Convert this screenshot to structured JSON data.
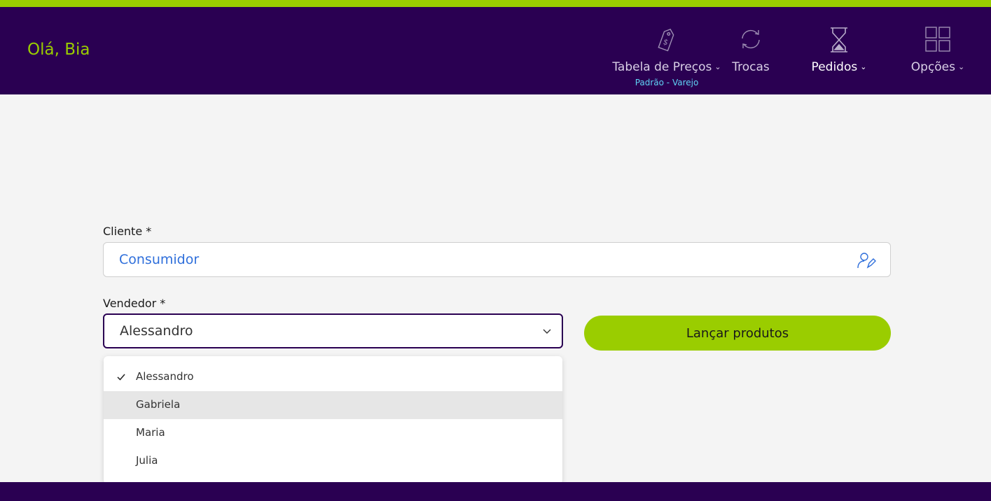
{
  "header": {
    "greeting": "Olá, Bia",
    "nav": {
      "price_table": {
        "label": "Tabela de Preços",
        "sublabel": "Padrão - Varejo",
        "icon": "price-tag-icon"
      },
      "exchanges": {
        "label": "Trocas",
        "icon": "refresh-icon"
      },
      "orders": {
        "label": "Pedidos",
        "icon": "hourglass-icon"
      },
      "options": {
        "label": "Opções",
        "icon": "grid-icon"
      }
    },
    "colors": {
      "background": "#2a0052",
      "accent": "#9acd00",
      "sublabel": "#5fd3f5"
    }
  },
  "form": {
    "client": {
      "label": "Cliente *",
      "value": "Consumidor",
      "icon": "user-edit-icon"
    },
    "seller": {
      "label": "Vendedor *",
      "value": "Alessandro",
      "options": [
        "Alessandro",
        "Gabriela",
        "Maria",
        "Julia"
      ],
      "selected_index": 0,
      "hover_index": 1
    },
    "launch_button": {
      "label": "Lançar produtos"
    }
  }
}
